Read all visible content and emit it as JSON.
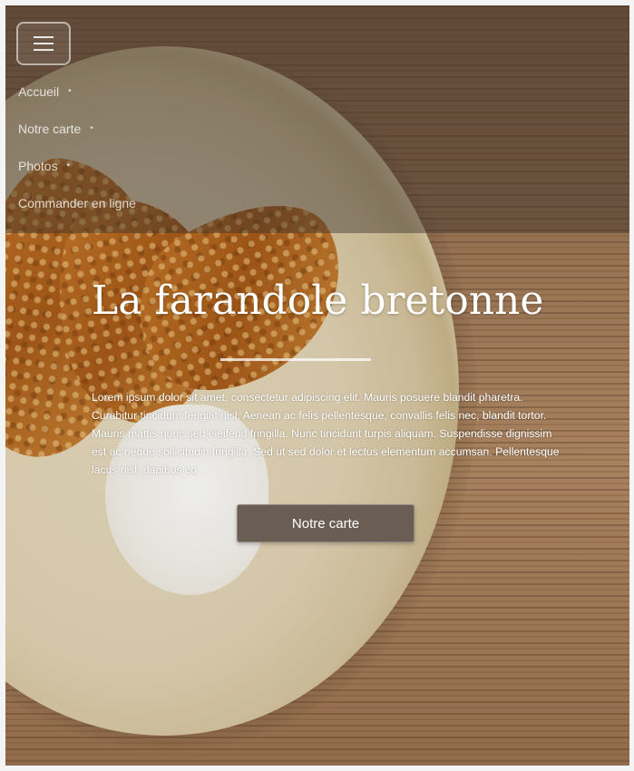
{
  "nav": {
    "menu_icon": "hamburger-menu-icon",
    "items": [
      {
        "label": "Accueil",
        "bullet": "•"
      },
      {
        "label": "Notre carte",
        "bullet": "•"
      },
      {
        "label": "Photos",
        "bullet": "•"
      },
      {
        "label": "Commander en ligne",
        "bullet": ""
      }
    ]
  },
  "hero": {
    "title": "La farandole bretonne",
    "text": "Lorem ipsum dolor sit amet, consectetur adipiscing elit. Mauris posuere blandit pharetra. Curabitur tincidunt feugiat nisl. Aenean ac felis pellentesque, convallis felis nec, blandit tortor. Mauris mattis nunc sed eleifend fringilla. Nunc tincidunt turpis aliquam. Suspendisse dignissim est ac neque sollicitudin fringilla. Sed ut sed dolor et lectus elementum accumsan. Pellentesque lacus nisl, dapibus co",
    "button_label": "Notre carte"
  },
  "colors": {
    "button_bg": "#6a5d53",
    "text": "#ffffff"
  }
}
